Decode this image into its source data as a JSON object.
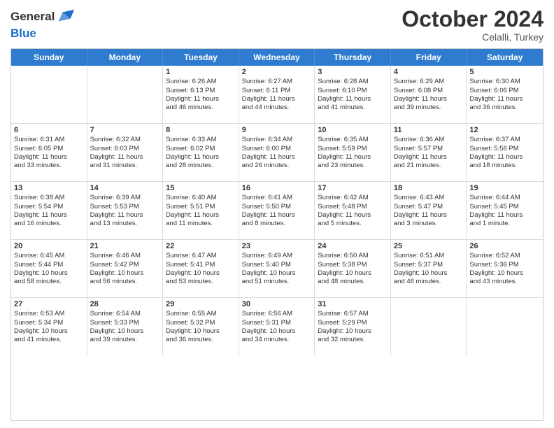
{
  "header": {
    "logo_line1": "General",
    "logo_line2": "Blue",
    "month": "October 2024",
    "location": "Celalli, Turkey"
  },
  "days_of_week": [
    "Sunday",
    "Monday",
    "Tuesday",
    "Wednesday",
    "Thursday",
    "Friday",
    "Saturday"
  ],
  "rows": [
    [
      {
        "day": "",
        "lines": []
      },
      {
        "day": "",
        "lines": []
      },
      {
        "day": "1",
        "lines": [
          "Sunrise: 6:26 AM",
          "Sunset: 6:13 PM",
          "Daylight: 11 hours",
          "and 46 minutes."
        ]
      },
      {
        "day": "2",
        "lines": [
          "Sunrise: 6:27 AM",
          "Sunset: 6:11 PM",
          "Daylight: 11 hours",
          "and 44 minutes."
        ]
      },
      {
        "day": "3",
        "lines": [
          "Sunrise: 6:28 AM",
          "Sunset: 6:10 PM",
          "Daylight: 11 hours",
          "and 41 minutes."
        ]
      },
      {
        "day": "4",
        "lines": [
          "Sunrise: 6:29 AM",
          "Sunset: 6:08 PM",
          "Daylight: 11 hours",
          "and 39 minutes."
        ]
      },
      {
        "day": "5",
        "lines": [
          "Sunrise: 6:30 AM",
          "Sunset: 6:06 PM",
          "Daylight: 11 hours",
          "and 36 minutes."
        ]
      }
    ],
    [
      {
        "day": "6",
        "lines": [
          "Sunrise: 6:31 AM",
          "Sunset: 6:05 PM",
          "Daylight: 11 hours",
          "and 33 minutes."
        ]
      },
      {
        "day": "7",
        "lines": [
          "Sunrise: 6:32 AM",
          "Sunset: 6:03 PM",
          "Daylight: 11 hours",
          "and 31 minutes."
        ]
      },
      {
        "day": "8",
        "lines": [
          "Sunrise: 6:33 AM",
          "Sunset: 6:02 PM",
          "Daylight: 11 hours",
          "and 28 minutes."
        ]
      },
      {
        "day": "9",
        "lines": [
          "Sunrise: 6:34 AM",
          "Sunset: 6:00 PM",
          "Daylight: 11 hours",
          "and 26 minutes."
        ]
      },
      {
        "day": "10",
        "lines": [
          "Sunrise: 6:35 AM",
          "Sunset: 5:59 PM",
          "Daylight: 11 hours",
          "and 23 minutes."
        ]
      },
      {
        "day": "11",
        "lines": [
          "Sunrise: 6:36 AM",
          "Sunset: 5:57 PM",
          "Daylight: 11 hours",
          "and 21 minutes."
        ]
      },
      {
        "day": "12",
        "lines": [
          "Sunrise: 6:37 AM",
          "Sunset: 5:56 PM",
          "Daylight: 11 hours",
          "and 18 minutes."
        ]
      }
    ],
    [
      {
        "day": "13",
        "lines": [
          "Sunrise: 6:38 AM",
          "Sunset: 5:54 PM",
          "Daylight: 11 hours",
          "and 16 minutes."
        ]
      },
      {
        "day": "14",
        "lines": [
          "Sunrise: 6:39 AM",
          "Sunset: 5:53 PM",
          "Daylight: 11 hours",
          "and 13 minutes."
        ]
      },
      {
        "day": "15",
        "lines": [
          "Sunrise: 6:40 AM",
          "Sunset: 5:51 PM",
          "Daylight: 11 hours",
          "and 11 minutes."
        ]
      },
      {
        "day": "16",
        "lines": [
          "Sunrise: 6:41 AM",
          "Sunset: 5:50 PM",
          "Daylight: 11 hours",
          "and 8 minutes."
        ]
      },
      {
        "day": "17",
        "lines": [
          "Sunrise: 6:42 AM",
          "Sunset: 5:48 PM",
          "Daylight: 11 hours",
          "and 5 minutes."
        ]
      },
      {
        "day": "18",
        "lines": [
          "Sunrise: 6:43 AM",
          "Sunset: 5:47 PM",
          "Daylight: 11 hours",
          "and 3 minutes."
        ]
      },
      {
        "day": "19",
        "lines": [
          "Sunrise: 6:44 AM",
          "Sunset: 5:45 PM",
          "Daylight: 11 hours",
          "and 1 minute."
        ]
      }
    ],
    [
      {
        "day": "20",
        "lines": [
          "Sunrise: 6:45 AM",
          "Sunset: 5:44 PM",
          "Daylight: 10 hours",
          "and 58 minutes."
        ]
      },
      {
        "day": "21",
        "lines": [
          "Sunrise: 6:46 AM",
          "Sunset: 5:42 PM",
          "Daylight: 10 hours",
          "and 56 minutes."
        ]
      },
      {
        "day": "22",
        "lines": [
          "Sunrise: 6:47 AM",
          "Sunset: 5:41 PM",
          "Daylight: 10 hours",
          "and 53 minutes."
        ]
      },
      {
        "day": "23",
        "lines": [
          "Sunrise: 6:49 AM",
          "Sunset: 5:40 PM",
          "Daylight: 10 hours",
          "and 51 minutes."
        ]
      },
      {
        "day": "24",
        "lines": [
          "Sunrise: 6:50 AM",
          "Sunset: 5:38 PM",
          "Daylight: 10 hours",
          "and 48 minutes."
        ]
      },
      {
        "day": "25",
        "lines": [
          "Sunrise: 6:51 AM",
          "Sunset: 5:37 PM",
          "Daylight: 10 hours",
          "and 46 minutes."
        ]
      },
      {
        "day": "26",
        "lines": [
          "Sunrise: 6:52 AM",
          "Sunset: 5:36 PM",
          "Daylight: 10 hours",
          "and 43 minutes."
        ]
      }
    ],
    [
      {
        "day": "27",
        "lines": [
          "Sunrise: 6:53 AM",
          "Sunset: 5:34 PM",
          "Daylight: 10 hours",
          "and 41 minutes."
        ]
      },
      {
        "day": "28",
        "lines": [
          "Sunrise: 6:54 AM",
          "Sunset: 5:33 PM",
          "Daylight: 10 hours",
          "and 39 minutes."
        ]
      },
      {
        "day": "29",
        "lines": [
          "Sunrise: 6:55 AM",
          "Sunset: 5:32 PM",
          "Daylight: 10 hours",
          "and 36 minutes."
        ]
      },
      {
        "day": "30",
        "lines": [
          "Sunrise: 6:56 AM",
          "Sunset: 5:31 PM",
          "Daylight: 10 hours",
          "and 34 minutes."
        ]
      },
      {
        "day": "31",
        "lines": [
          "Sunrise: 6:57 AM",
          "Sunset: 5:29 PM",
          "Daylight: 10 hours",
          "and 32 minutes."
        ]
      },
      {
        "day": "",
        "lines": []
      },
      {
        "day": "",
        "lines": []
      }
    ]
  ]
}
